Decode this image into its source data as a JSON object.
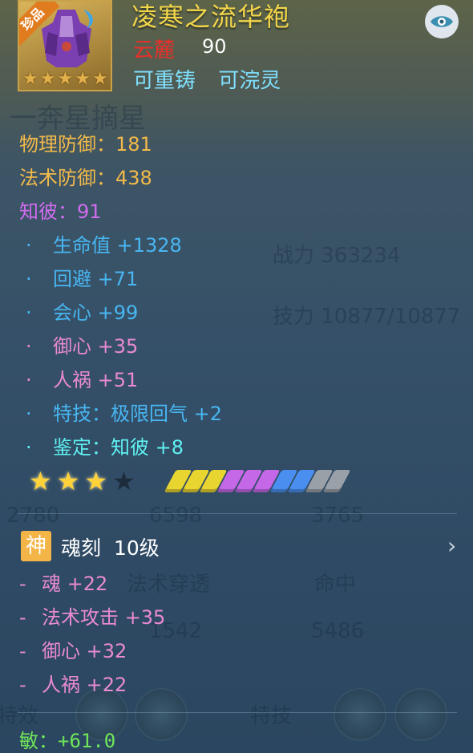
{
  "background_fragments": [
    "一奔星摘星",
    "战力 363234",
    "技力 10877/10877",
    "2780",
    "6598",
    "3765",
    "法术穿透",
    "命中",
    "1542",
    "5486",
    "特技",
    "特效"
  ],
  "item": {
    "rarity_tag": "珍品",
    "name": "凌寒之流华袍",
    "school": "云麓",
    "level": "90",
    "tags": "可重铸 可浣灵",
    "icon_stars": [
      "★",
      "★",
      "★",
      "★",
      "★"
    ]
  },
  "base_stats": [
    {
      "label": "物理防御：",
      "value": "181"
    },
    {
      "label": "法术防御：",
      "value": "438"
    },
    {
      "label": "知彼：",
      "value": "91"
    }
  ],
  "bonus_stats": [
    {
      "text": "生命值 +1328",
      "color": "blue"
    },
    {
      "text": "回避 +71",
      "color": "blue"
    },
    {
      "text": "会心 +99",
      "color": "blue"
    },
    {
      "text": "御心 +35",
      "color": "pink"
    },
    {
      "text": "人祸 +51",
      "color": "pink"
    },
    {
      "text": "特技：极限回气 +2",
      "color": "blue"
    },
    {
      "text": "鉴定：知彼 +8",
      "color": "cyan"
    }
  ],
  "bullet_char": "·",
  "stars": {
    "filled": 3,
    "total": 4
  },
  "gem_colors": [
    "#e8d530",
    "#e8d530",
    "#e8d530",
    "#c568e8",
    "#c568e8",
    "#c568e8",
    "#4a8ff0",
    "#4a8ff0",
    "#9aa0a8",
    "#9aa0a8"
  ],
  "soul_carving": {
    "badge": "神",
    "title": "魂刻 10级",
    "lines": [
      {
        "text": "魂 +22"
      },
      {
        "text": "法术攻击 +35"
      },
      {
        "text": "御心 +32"
      },
      {
        "text": "人祸 +22"
      }
    ],
    "dash": "-"
  },
  "footer_stat": "敏：+61.0",
  "colors": {
    "title": "#f2d64a",
    "school": "#e8302a",
    "tags": "#7fe0ff"
  }
}
